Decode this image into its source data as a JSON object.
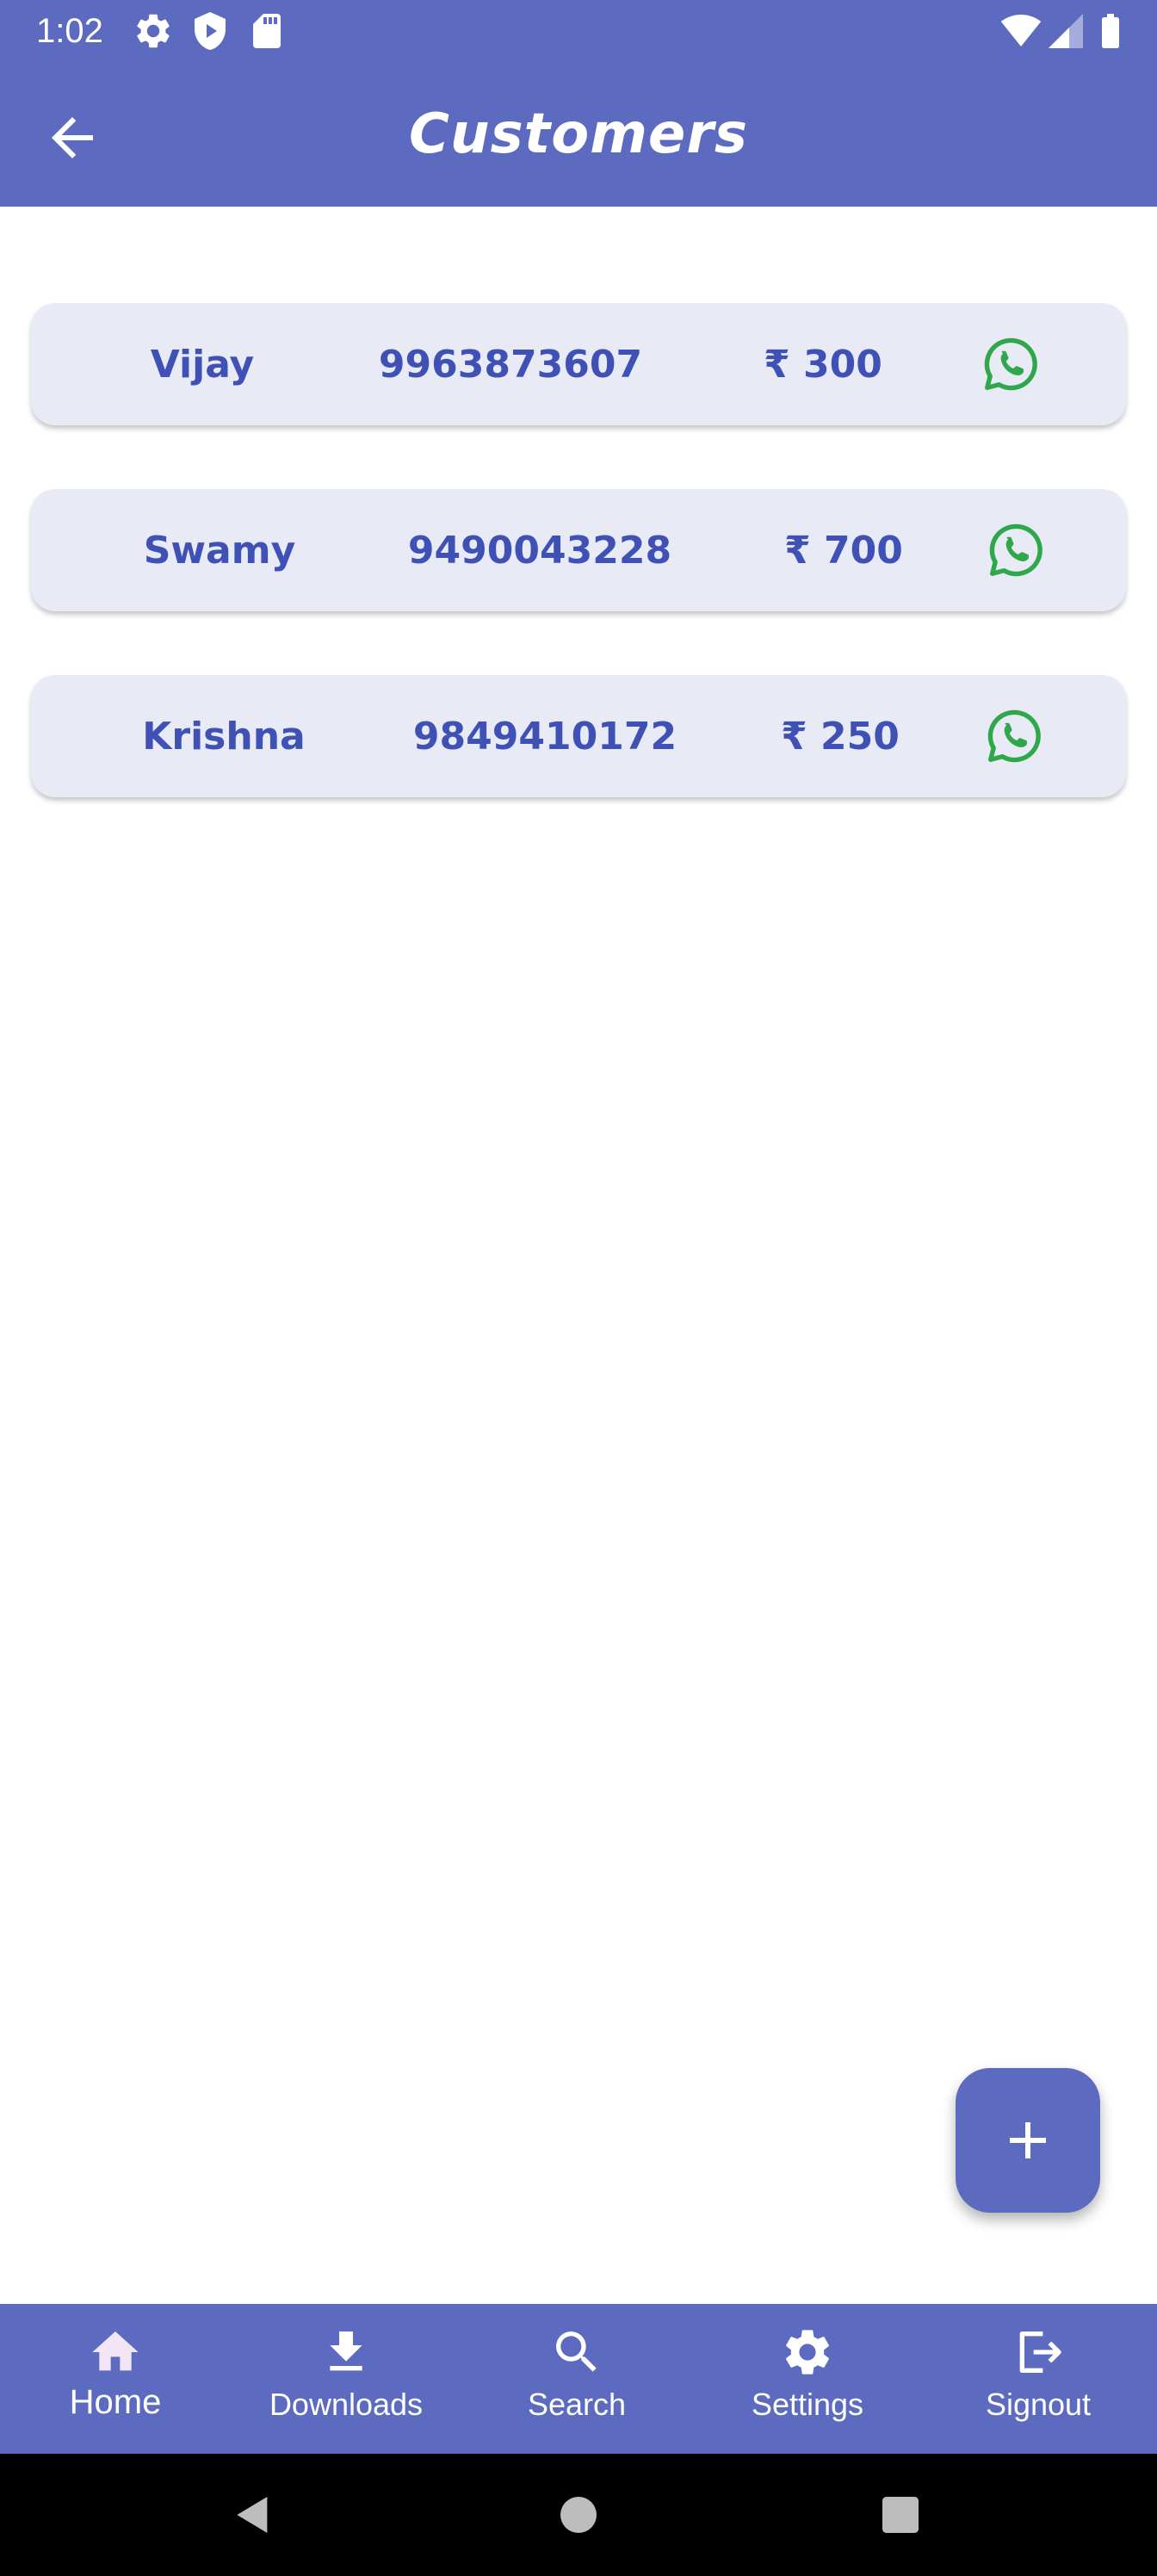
{
  "status_bar": {
    "time": "1:02",
    "icons": [
      "gear-icon",
      "shield-icon",
      "sd-card-icon",
      "wifi-icon",
      "cellular-signal-icon",
      "battery-icon"
    ]
  },
  "app_bar": {
    "title": "Customers",
    "back_icon": "arrow-back-icon"
  },
  "customers": [
    {
      "name": "Vijay",
      "phone": "9963873607",
      "amount": "₹ 300",
      "action_icon": "whatsapp-icon"
    },
    {
      "name": "Swamy",
      "phone": "9490043228",
      "amount": "₹ 700",
      "action_icon": "whatsapp-icon"
    },
    {
      "name": "Krishna",
      "phone": "9849410172",
      "amount": "₹ 250",
      "action_icon": "whatsapp-icon"
    }
  ],
  "fab": {
    "icon": "plus-icon"
  },
  "bottom_nav": {
    "items": [
      {
        "label": "Home",
        "icon": "home-icon",
        "active": true
      },
      {
        "label": "Downloads",
        "icon": "download-icon",
        "active": false
      },
      {
        "label": "Search",
        "icon": "search-icon",
        "active": false
      },
      {
        "label": "Settings",
        "icon": "gear-icon",
        "active": false
      },
      {
        "label": "Signout",
        "icon": "logout-icon",
        "active": false
      }
    ]
  },
  "colors": {
    "primary": "#5C6BC0",
    "card_bg": "#E8EAF6",
    "text_accent": "#3F51B5",
    "whatsapp_green": "#2EA84A",
    "active_icon": "#F3E5F5"
  }
}
